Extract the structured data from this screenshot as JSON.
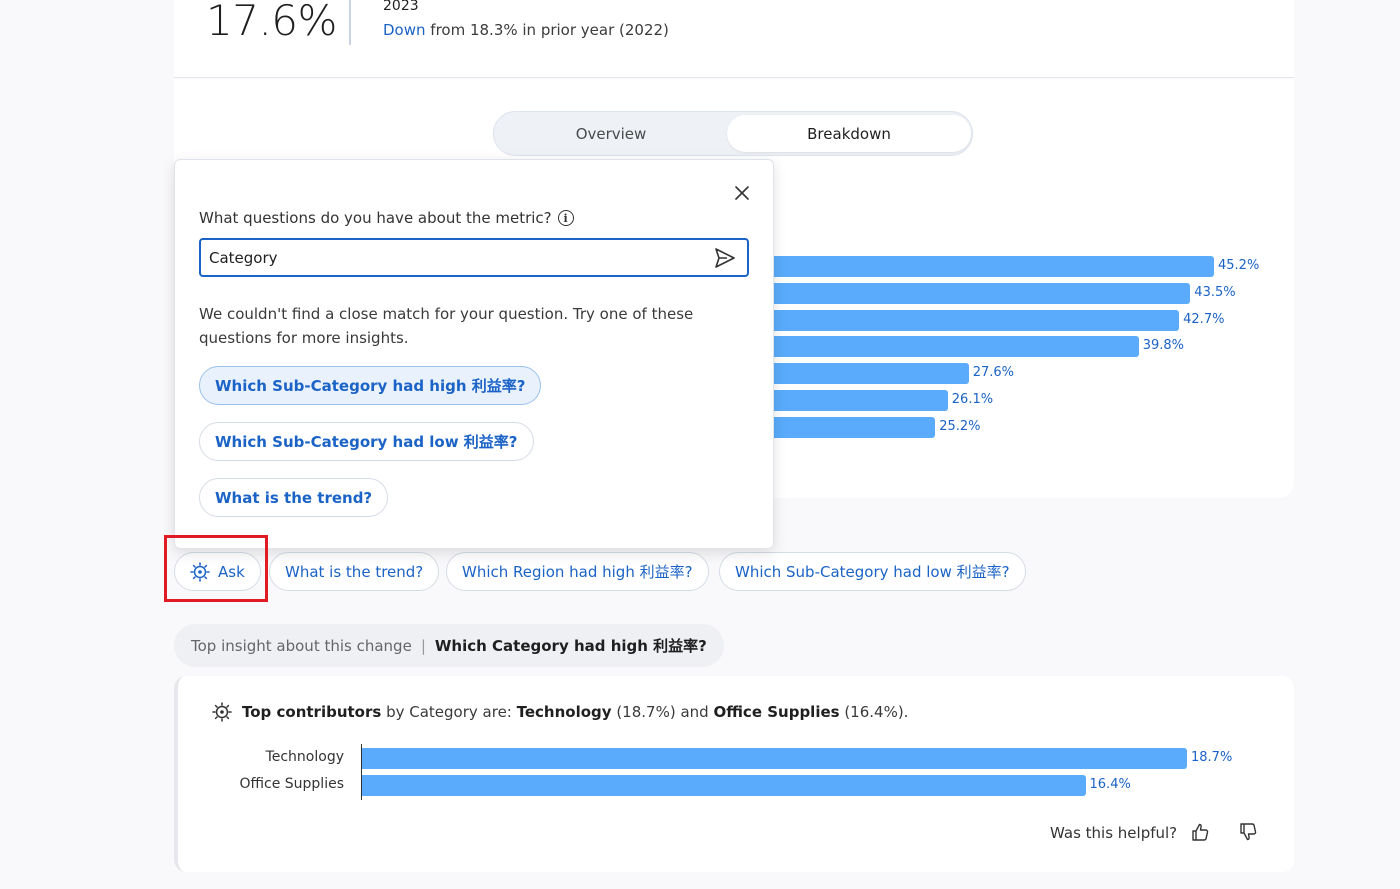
{
  "metric": {
    "value": "17.6%",
    "year": "2023",
    "change_direction": "Down",
    "change_text": " from 18.3% in prior year (2022)"
  },
  "tabs": {
    "overview": "Overview",
    "breakdown": "Breakdown"
  },
  "breakdown_chart": {
    "type": "bar",
    "values": [
      45.2,
      43.5,
      42.7,
      39.8,
      27.6,
      26.1,
      25.2
    ],
    "labels": [
      "45.2%",
      "43.5%",
      "42.7%",
      "39.8%",
      "27.6%",
      "26.1%",
      "25.2%"
    ]
  },
  "popup": {
    "question_label": "What questions do you have about the metric?",
    "input_value": "Category",
    "no_match_text": "We couldn't find a close match for your question. Try one of these questions for more insights.",
    "suggestions": [
      "Which Sub-Category had high 利益率?",
      "Which Sub-Category had low 利益率?",
      "What is the trend?"
    ]
  },
  "chips": {
    "ask": "Ask",
    "items": [
      "What is the trend?",
      "Which Region had high 利益率?",
      "Which Sub-Category had low 利益率?"
    ]
  },
  "insight": {
    "label": "Top insight about this change",
    "question": "Which Category had high 利益率?",
    "summary_1": "Top contributors",
    "summary_2": " by Category are: ",
    "item_1": "Technology",
    "item_1_value": " (18.7%) and ",
    "item_2": "Office Supplies",
    "item_2_value": " (16.4%).",
    "helpful_text": "Was this helpful?"
  },
  "chart_data": {
    "type": "bar",
    "categories": [
      "Technology",
      "Office Supplies"
    ],
    "values": [
      18.7,
      16.4
    ],
    "labels": [
      "18.7%",
      "16.4%"
    ]
  },
  "colors": {
    "accent": "#1b63c6",
    "bar": "#5aabfb",
    "highlight": "#e01b24"
  }
}
